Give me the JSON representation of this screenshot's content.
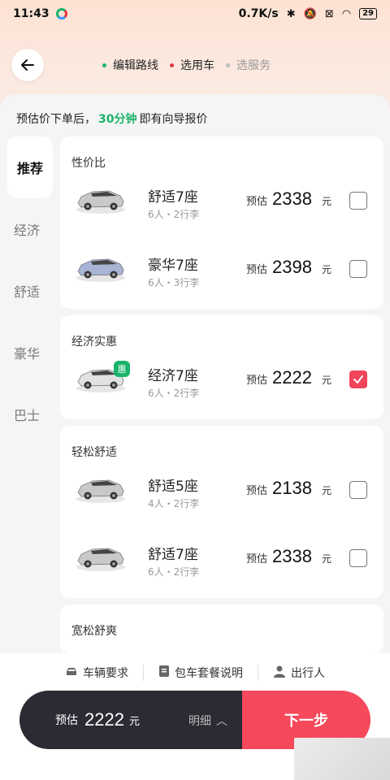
{
  "status_bar": {
    "time": "11:43",
    "speed": "0.7K/s",
    "battery": "29"
  },
  "nav": {
    "steps": [
      {
        "label": "编辑路线",
        "state": "done",
        "dot_color": "#1ab36a"
      },
      {
        "label": "选用车",
        "state": "current",
        "dot_color": "#e0334a"
      },
      {
        "label": "选服务",
        "state": "todo",
        "dot_color": "#bbbbbb"
      }
    ]
  },
  "notice": {
    "prefix": "预估价下单后，",
    "highlight": "30分钟",
    "suffix": "即有向导报价"
  },
  "side_tabs": [
    {
      "label": "推荐",
      "active": true
    },
    {
      "label": "经济",
      "active": false
    },
    {
      "label": "舒适",
      "active": false
    },
    {
      "label": "豪华",
      "active": false
    },
    {
      "label": "巴士",
      "active": false
    }
  ],
  "groups": [
    {
      "title": "性价比",
      "cars": [
        {
          "name": "舒适7座",
          "sub": "6人・2行李",
          "price_label": "预估",
          "price": "2338",
          "unit": "元",
          "checked": false,
          "badge": "",
          "color": "#c9c9cc"
        },
        {
          "name": "豪华7座",
          "sub": "6人・3行李",
          "price_label": "预估",
          "price": "2398",
          "unit": "元",
          "checked": false,
          "badge": "",
          "color": "#a8b4d6"
        }
      ]
    },
    {
      "title": "经济实惠",
      "cars": [
        {
          "name": "经济7座",
          "sub": "6人・2行李",
          "price_label": "预估",
          "price": "2222",
          "unit": "元",
          "checked": true,
          "badge": "惠",
          "color": "#e2e2e2"
        }
      ]
    },
    {
      "title": "轻松舒适",
      "cars": [
        {
          "name": "舒适5座",
          "sub": "4人・2行李",
          "price_label": "预估",
          "price": "2138",
          "unit": "元",
          "checked": false,
          "badge": "",
          "color": "#c9c9cc"
        },
        {
          "name": "舒适7座",
          "sub": "6人・2行李",
          "price_label": "预估",
          "price": "2338",
          "unit": "元",
          "checked": false,
          "badge": "",
          "color": "#c9c9cc"
        }
      ]
    },
    {
      "title": "宽松舒爽",
      "cars": []
    }
  ],
  "bottom": {
    "options": [
      {
        "label": "车辆要求",
        "icon": "car-icon"
      },
      {
        "label": "包车套餐说明",
        "icon": "document-icon"
      },
      {
        "label": "出行人",
        "icon": "person-icon"
      }
    ],
    "estimate_label": "预估",
    "estimate_price": "2222",
    "estimate_unit": "元",
    "detail_label": "明细",
    "next_label": "下一步"
  },
  "colors": {
    "accent_green": "#1ab36a",
    "accent_red": "#f6495c",
    "dark": "#2a2b33"
  }
}
